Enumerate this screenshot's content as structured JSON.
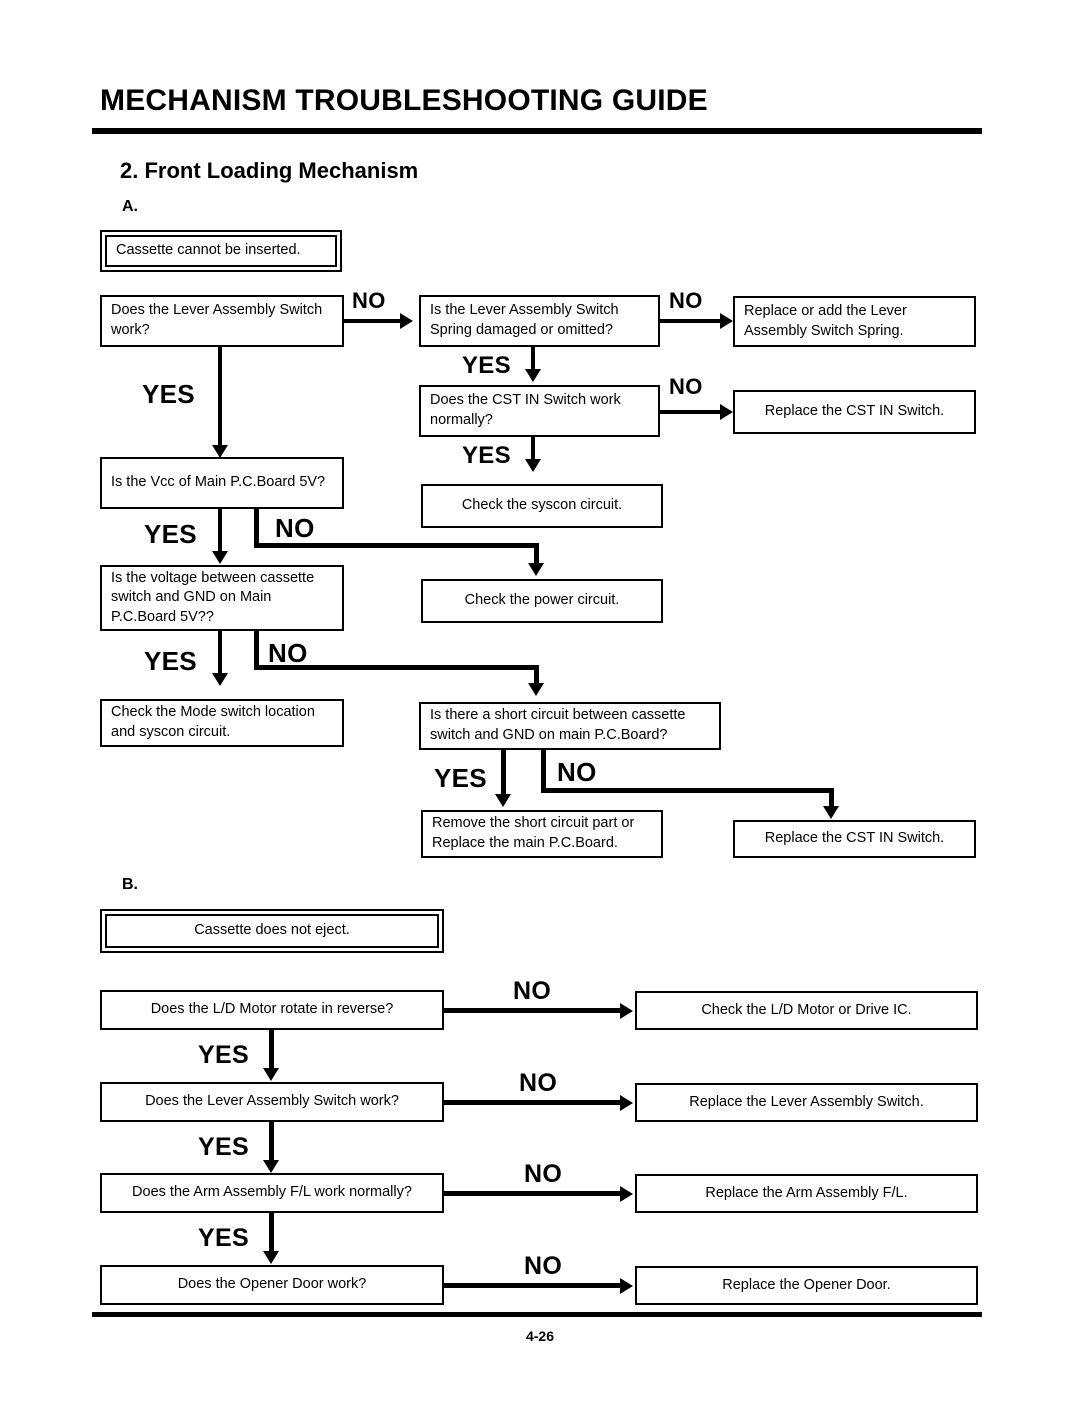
{
  "header": {
    "title": "MECHANISM TROUBLESHOOTING GUIDE",
    "section_title": "2. Front Loading Mechanism"
  },
  "footer": {
    "page_number": "4-26"
  },
  "labels": {
    "yes": "YES",
    "no": "NO",
    "chart_a": "A.",
    "chart_b": "B."
  },
  "chart_a": {
    "start": "Cassette cannot be inserted.",
    "q1": "Does the Lever Assembly Switch work?",
    "q2": "Is the Lever Assembly Switch Spring damaged or omitted?",
    "a2_no": "Replace or add the Lever Assembly Switch Spring.",
    "q3": "Does the CST IN Switch work normally?",
    "a3_no": "Replace the CST IN Switch.",
    "a3_yes": "Check the syscon circuit.",
    "q4": "Is the Vcc of Main P.C.Board 5V?",
    "a4_no": "Check the power circuit.",
    "q5": "Is the voltage between cassette switch and GND on Main P.C.Board 5V??",
    "a5_yes": "Check the Mode switch location and syscon circuit.",
    "q6": "Is there a short circuit between cassette switch and GND on main P.C.Board?",
    "a6_yes": "Remove the short circuit part or Replace the main P.C.Board.",
    "a6_no": "Replace the CST IN Switch."
  },
  "chart_b": {
    "start": "Cassette does not eject.",
    "q1": "Does the L/D Motor rotate in reverse?",
    "a1_no": "Check the L/D Motor or Drive IC.",
    "q2": "Does the Lever Assembly Switch work?",
    "a2_no": "Replace the Lever Assembly Switch.",
    "q3": "Does the Arm Assembly F/L work normally?",
    "a3_no": "Replace the Arm Assembly F/L.",
    "q4": "Does the Opener Door work?",
    "a4_no": "Replace the Opener Door."
  }
}
